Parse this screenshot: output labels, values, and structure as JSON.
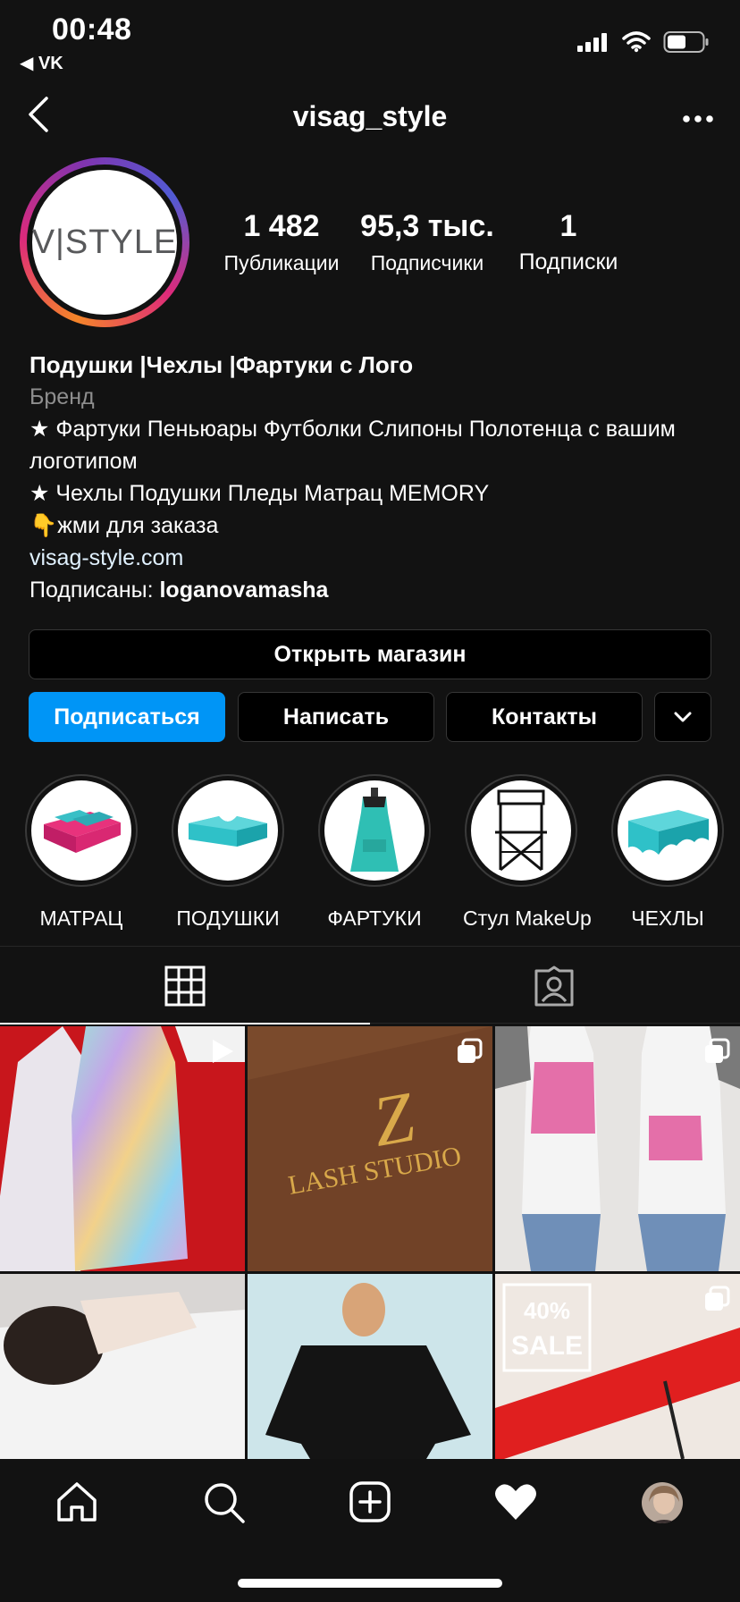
{
  "status_bar": {
    "time": "00:48",
    "back_app": "◀ VK"
  },
  "nav": {
    "title": "visag_style"
  },
  "profile": {
    "avatar_logo": "V|STYLE",
    "stats": [
      {
        "value": "1 482",
        "label": "Публикации"
      },
      {
        "value": "95,3 тыс.",
        "label": "Подписчики"
      },
      {
        "value": "1",
        "label": "Подписки"
      }
    ],
    "bio": {
      "name": "Подушки |Чехлы |Фартуки с Лого",
      "category": "Бренд",
      "line1": "★ Фартуки Пеньюары Футболки Слипоны Полотенца с вашим логотипом",
      "line2": "★ Чехлы Подушки Пледы Матрац MEMORY",
      "line3": "👇жми для заказа",
      "website": "visag-style.com",
      "followed_by_prefix": "Подписаны: ",
      "followed_by_user": "loganovamasha"
    }
  },
  "buttons": {
    "shop": "Открыть магазин",
    "follow": "Подписаться",
    "message": "Написать",
    "contacts": "Контакты"
  },
  "highlights": [
    {
      "label": "МАТРАЦ"
    },
    {
      "label": "ПОДУШКИ"
    },
    {
      "label": "ФАРТУКИ"
    },
    {
      "label": "Стул MakeUp"
    },
    {
      "label": "ЧЕХЛЫ"
    }
  ],
  "posts": {
    "tile2_text": "LASH STUDIO",
    "tile6_badge": "40%",
    "tile6_badge2": "SALE"
  },
  "colors": {
    "accent": "#0095f6",
    "background": "#121212"
  }
}
